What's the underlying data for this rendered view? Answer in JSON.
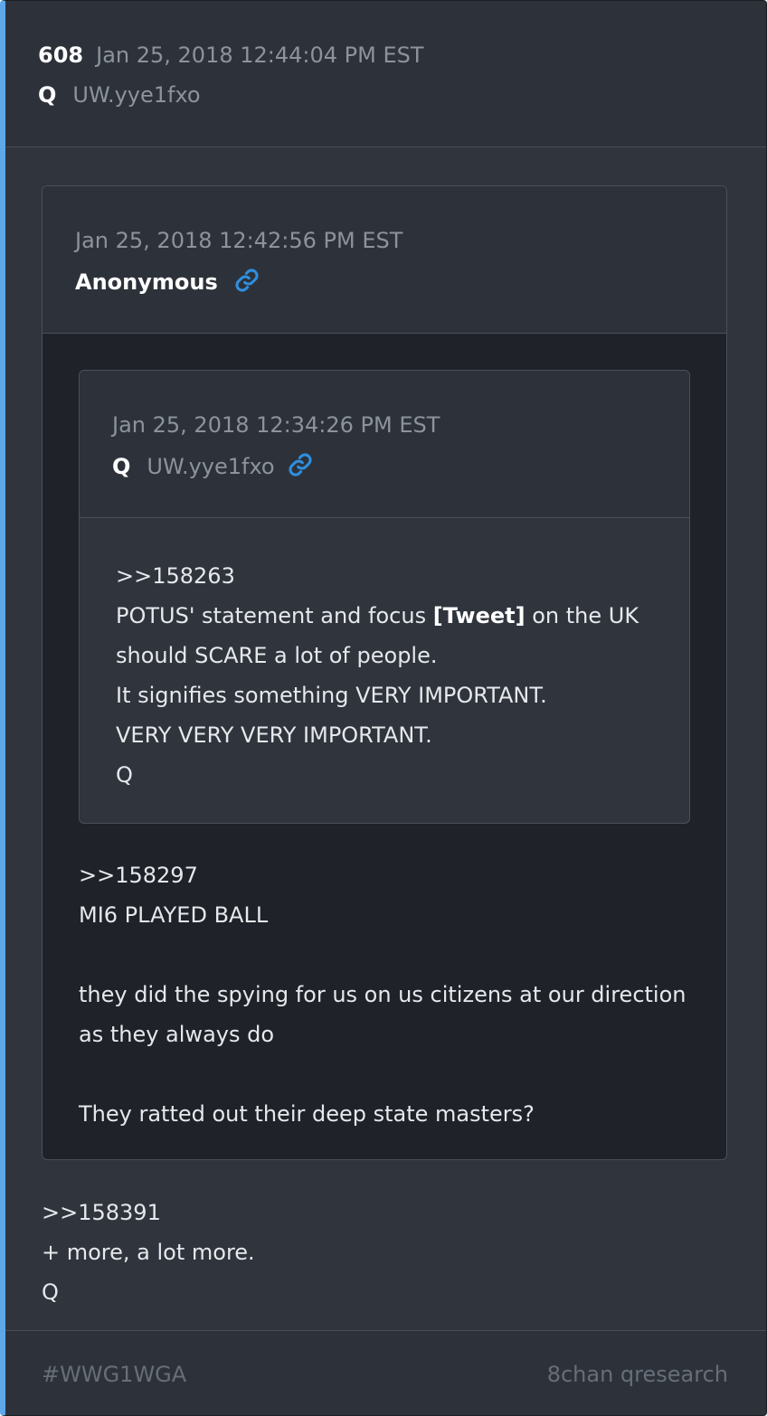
{
  "post": {
    "number": "608",
    "timestamp": "Jan 25, 2018 12:44:04 PM EST",
    "author": "Q",
    "trip": "UW.yye1fxo",
    "body_lines": [
      ">>158391",
      "+ more, a lot more.",
      "Q"
    ]
  },
  "quote1": {
    "timestamp": "Jan 25, 2018 12:42:56 PM EST",
    "author": "Anonymous",
    "body_lines": [
      ">>158297",
      "MI6 PLAYED BALL",
      "",
      "they did the spying for us on us citizens at our direction",
      "as they always do",
      "",
      "They ratted out their deep state masters?"
    ]
  },
  "quote2": {
    "timestamp": "Jan 25, 2018 12:34:26 PM EST",
    "author": "Q",
    "trip": "UW.yye1fxo",
    "body": {
      "line1": ">>158263",
      "line2_before": "POTUS' statement and focus ",
      "line2_bold": "[Tweet]",
      "line2_after": " on the UK",
      "line3": "should SCARE a lot of people.",
      "line4": "It signifies something VERY IMPORTANT.",
      "line5": "VERY VERY VERY IMPORTANT.",
      "line6": "Q"
    }
  },
  "footer": {
    "tag": "#WWG1WGA",
    "source": "8chan qresearch"
  },
  "icons": {
    "link": "link-icon"
  },
  "colors": {
    "accent_bar": "#5da8e8",
    "link_icon": "#2f8fe0",
    "background": "#2f343d"
  }
}
